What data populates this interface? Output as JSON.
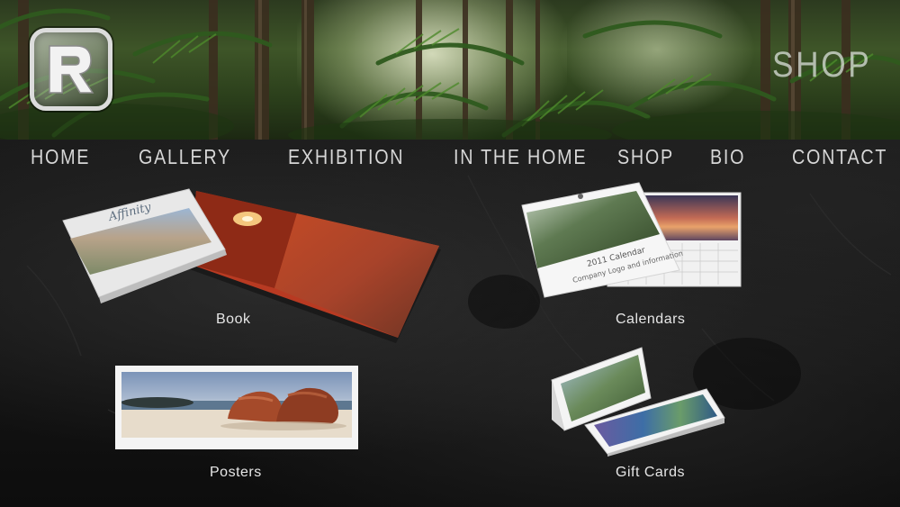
{
  "header": {
    "page_title": "SHOP",
    "logo_icon": "r-logo-icon"
  },
  "nav": {
    "items": [
      {
        "label": "HOME"
      },
      {
        "label": "GALLERY"
      },
      {
        "label": "EXHIBITION"
      },
      {
        "label": "IN THE HOME"
      },
      {
        "label": "SHOP"
      },
      {
        "label": "BIO"
      },
      {
        "label": "CONTACT"
      }
    ]
  },
  "products": {
    "book": {
      "label": "Book",
      "cover_title": "Affinity"
    },
    "calendars": {
      "label": "Calendars",
      "cover_title": "2011 Calendar",
      "cover_subtitle": "Company Logo and information"
    },
    "posters": {
      "label": "Posters"
    },
    "gift_cards": {
      "label": "Gift Cards"
    }
  },
  "colors": {
    "nav_text": "#d6d6d6",
    "label_text": "#e6e6e6",
    "background": "#141414"
  }
}
